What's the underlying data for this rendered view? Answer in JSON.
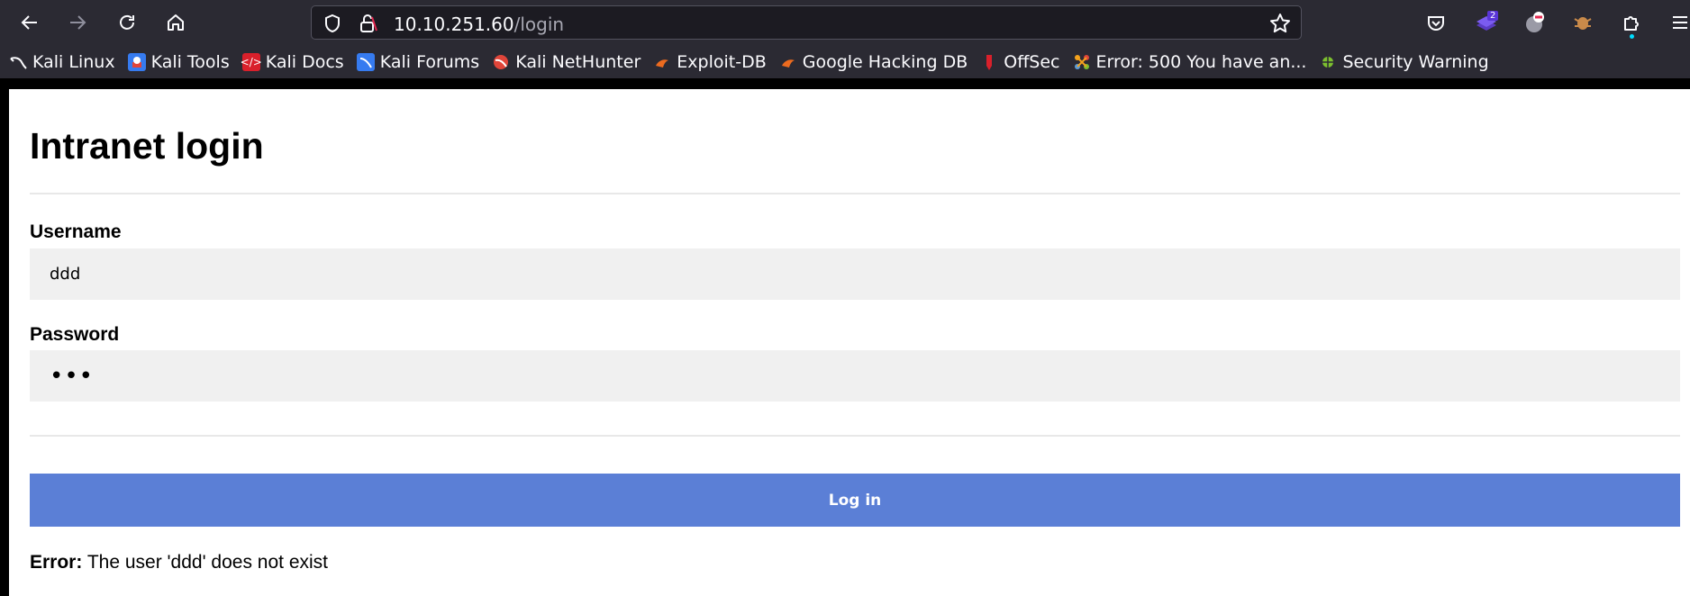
{
  "browser": {
    "url_host": "10.10.251.60",
    "url_path": "/login",
    "extension_badge": "2",
    "bookmarks": [
      {
        "label": "Kali Linux",
        "icon": "kali-dragon-icon",
        "color": "#367bf0"
      },
      {
        "label": "Kali Tools",
        "icon": "kali-tools-icon",
        "color": "#e0453a"
      },
      {
        "label": "Kali Docs",
        "icon": "kali-docs-icon",
        "color": "#d9202b"
      },
      {
        "label": "Kali Forums",
        "icon": "kali-forums-icon",
        "color": "#367bf0"
      },
      {
        "label": "Kali NetHunter",
        "icon": "nethunter-icon",
        "color": "#e0453a"
      },
      {
        "label": "Exploit-DB",
        "icon": "exploitdb-icon",
        "color": "#ec6b1f"
      },
      {
        "label": "Google Hacking DB",
        "icon": "ghdb-icon",
        "color": "#ec6b1f"
      },
      {
        "label": "OffSec",
        "icon": "offsec-icon",
        "color": "#d9202b"
      },
      {
        "label": "Error: 500 You have an...",
        "icon": "joomla-icon",
        "color": "#f4a21d"
      },
      {
        "label": "Security Warning",
        "icon": "security-warning-icon",
        "color": "#7cbf2f"
      }
    ]
  },
  "page": {
    "title": "Intranet login",
    "username_label": "Username",
    "username_value": "ddd",
    "password_label": "Password",
    "password_value": "ddd",
    "login_button": "Log in",
    "error_label": "Error:",
    "error_message": "The user 'ddd' does not exist",
    "accent_color": "#5b7fd6"
  }
}
